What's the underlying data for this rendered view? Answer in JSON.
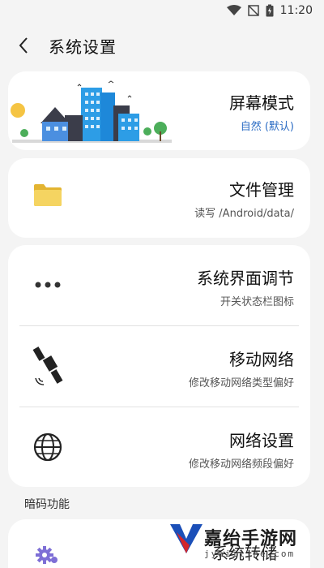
{
  "status_bar": {
    "time": "11:20"
  },
  "header": {
    "title": "系统设置"
  },
  "display_card": {
    "title": "屏幕模式",
    "subtitle": "自然 (默认)"
  },
  "files_card": {
    "title": "文件管理",
    "subtitle": "读写 /Android/data/"
  },
  "system_card": {
    "items": [
      {
        "title": "系统界面调节",
        "subtitle": "开关状态栏图标"
      },
      {
        "title": "移动网络",
        "subtitle": "修改移动网络类型偏好"
      },
      {
        "title": "网络设置",
        "subtitle": "修改移动网络频段偏好"
      }
    ]
  },
  "section": {
    "label": "暗码功能"
  },
  "partial_item": {
    "title": "系统转储"
  },
  "watermark": {
    "title": "嘉绐手游网",
    "domain": "jyaiiline.com"
  },
  "colors": {
    "accent": "#2b6cc4",
    "folder": "#f2cc4a",
    "background": "#f4f4f4",
    "card": "#ffffff"
  }
}
